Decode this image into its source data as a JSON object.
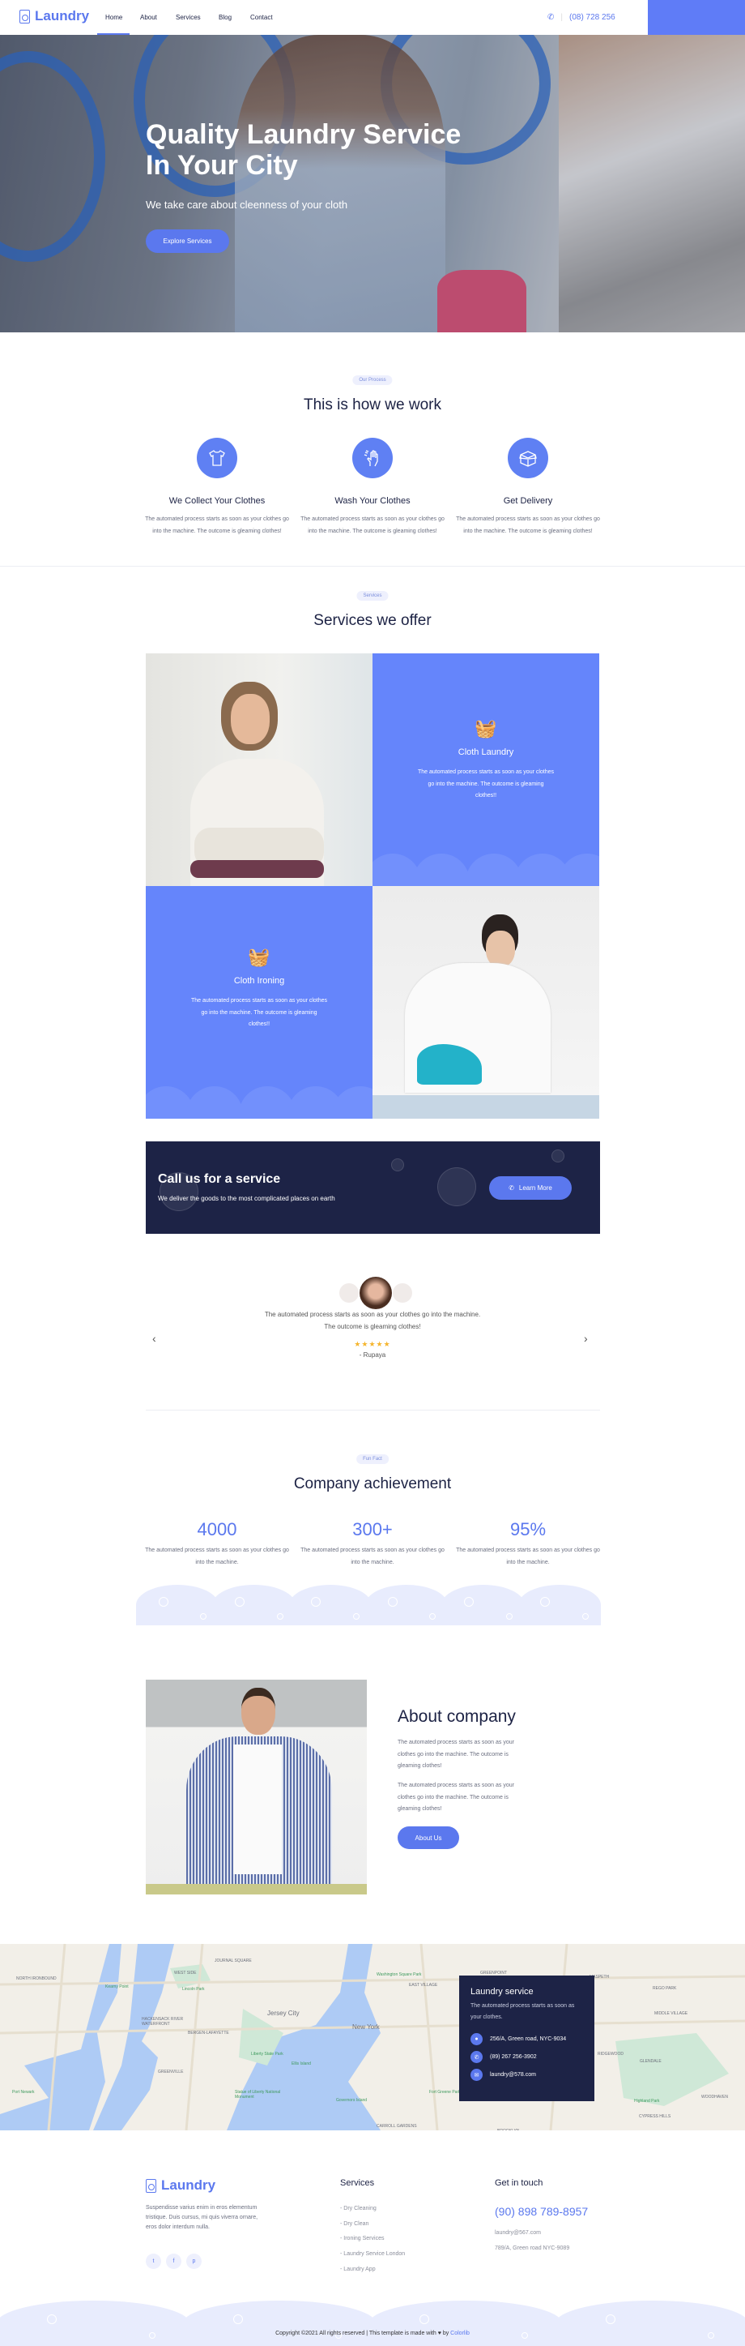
{
  "header": {
    "logo": "Laundry",
    "nav": [
      "Home",
      "About",
      "Services",
      "Blog",
      "Contact"
    ],
    "active": "Home",
    "phone": "(08) 728 256"
  },
  "hero": {
    "title": "Quality Laundry Service In Your City",
    "subtitle": "We take care about cleenness of your cloth",
    "button": "Explore Services"
  },
  "process": {
    "badge": "Our Process",
    "title": "This is how we work",
    "items": [
      {
        "icon": "tshirt-icon",
        "title": "We Collect Your Clothes",
        "text": "The automated process starts as soon as your clothes go into the machine. The outcome is gleaming clothes!"
      },
      {
        "icon": "hand-wash-icon",
        "title": "Wash Your Clothes",
        "text": "The automated process starts as soon as your clothes go into the machine. The outcome is gleaming clothes!"
      },
      {
        "icon": "box-icon",
        "title": "Get Delivery",
        "text": "The automated process starts as soon as your clothes go into the machine. The outcome is gleaming clothes!"
      }
    ]
  },
  "services": {
    "badge": "Services",
    "title": "Services we offer",
    "items": [
      {
        "title": "Cloth Laundry",
        "text": "The automated process starts as soon as your clothes go into the machine. The outcome is gleaming clothes!!"
      },
      {
        "title": "Cloth Ironing",
        "text": "The automated process starts as soon as your clothes go into the machine. The outcome is gleaming clothes!!"
      }
    ]
  },
  "cta": {
    "title": "Call us for a service",
    "subtitle": "We deliver the goods to the most complicated places on earth",
    "button": "Learn More"
  },
  "testimonial": {
    "quote": "The automated process starts as soon as your clothes go into the machine. The outcome is gleaming clothes!",
    "rating": 5,
    "author": "- Rupaya"
  },
  "achievement": {
    "badge": "Fun Fact",
    "title": "Company achievement",
    "stats": [
      {
        "value": "4000",
        "text": "The automated process starts as soon as your clothes go into the machine."
      },
      {
        "value": "300+",
        "text": "The automated process starts as soon as your clothes go into the machine."
      },
      {
        "value": "95%",
        "text": "The automated process starts as soon as your clothes go into the machine."
      }
    ]
  },
  "about": {
    "title": "About company",
    "p1": "The automated process starts as soon as your clothes go into the machine. The outcome is gleaming clothes!",
    "p2": "The automated process starts as soon as your clothes go into the machine. The outcome is gleaming clothes!",
    "button": "About Us"
  },
  "map": {
    "labels": [
      "NORTH IRONBOUND",
      "Kearny Point",
      "JOURNAL SQUARE",
      "WEST SIDE",
      "Lincoln Park",
      "HACKENSACK RIVER WATERFRONT",
      "BERGEN-LAFAYETTE",
      "Jersey City",
      "Liberty State Park",
      "GREENVILLE",
      "Port Newark",
      "Statue of Liberty National Monument",
      "Ellis Island",
      "Governors Island",
      "New York",
      "Washington Square Park",
      "EAST VILLAGE",
      "GREENPOINT",
      "MASPETH",
      "REGO PARK",
      "MIDDLE VILLAGE",
      "RIDGEWOOD",
      "GLENDALE",
      "Highland Park",
      "CYPRESS HILLS",
      "WOODHAVEN",
      "BROOKLYN",
      "Fort Greene Park",
      "CARROLL GARDENS"
    ],
    "card": {
      "title": "Laundry service",
      "text": "The automated process starts as soon as your clothes.",
      "address": "256/A, Green road, NYC-9034",
      "phone": "(89) 267 256-3902",
      "email": "laundry@578.com"
    }
  },
  "footer": {
    "logo": "Laundry",
    "desc": "Suspendisse varius enim in eros elementum tristique. Duis cursus, mi quis viverra ornare, eros dolor interdum nulla.",
    "social": [
      "twitter-icon",
      "facebook-icon",
      "pinterest-icon"
    ],
    "services_title": "Services",
    "services": [
      "- Dry Cleaning",
      "- Dry Clean",
      "- Ironing Services",
      "- Laundry Service London",
      "- Laundry App"
    ],
    "contact_title": "Get in touch",
    "phone": "(90) 898 789-8957",
    "email": "laundry@567.com",
    "address": "789/A, Green road NYC-9089",
    "copyright": "Copyright ©2021 All rights reserved | This template is made with",
    "by": "by",
    "credit": "Colorlib"
  },
  "colors": {
    "accent": "#5b78ee",
    "service_blue": "#6585fb",
    "navy": "#1d2346",
    "star": "#f5b52e"
  }
}
